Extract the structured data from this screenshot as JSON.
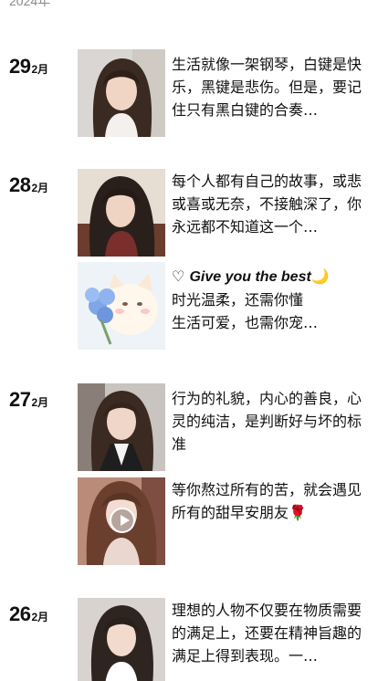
{
  "year": "2024年",
  "entries": [
    {
      "day": "29",
      "month": "2月",
      "text": "生活就像一架钢琴，白键是快乐，黑键是悲伤。但是，要记住只有黑白键的合奏…"
    },
    {
      "day": "28",
      "month": "2月",
      "text": "每个人都有自己的故事，或悲或喜或无奈，不接触深了，你永远都不知道这一个…"
    },
    {
      "heart": "♡",
      "en_text": "Give you the best",
      "moon": "🌙",
      "text": "时光温柔，还需你懂\n生活可爱，也需你宠…"
    },
    {
      "day": "27",
      "month": "2月",
      "text": "行为的礼貌，内心的善良，心灵的纯洁，是判断好与坏的标准"
    },
    {
      "text": "等你熬过所有的苦，就会遇见所有的甜早安朋友",
      "rose": "🌹"
    },
    {
      "day": "26",
      "month": "2月",
      "text": "理想的人物不仅要在物质需要的满足上，还要在精神旨趣的满足上得到表现。一…"
    }
  ]
}
